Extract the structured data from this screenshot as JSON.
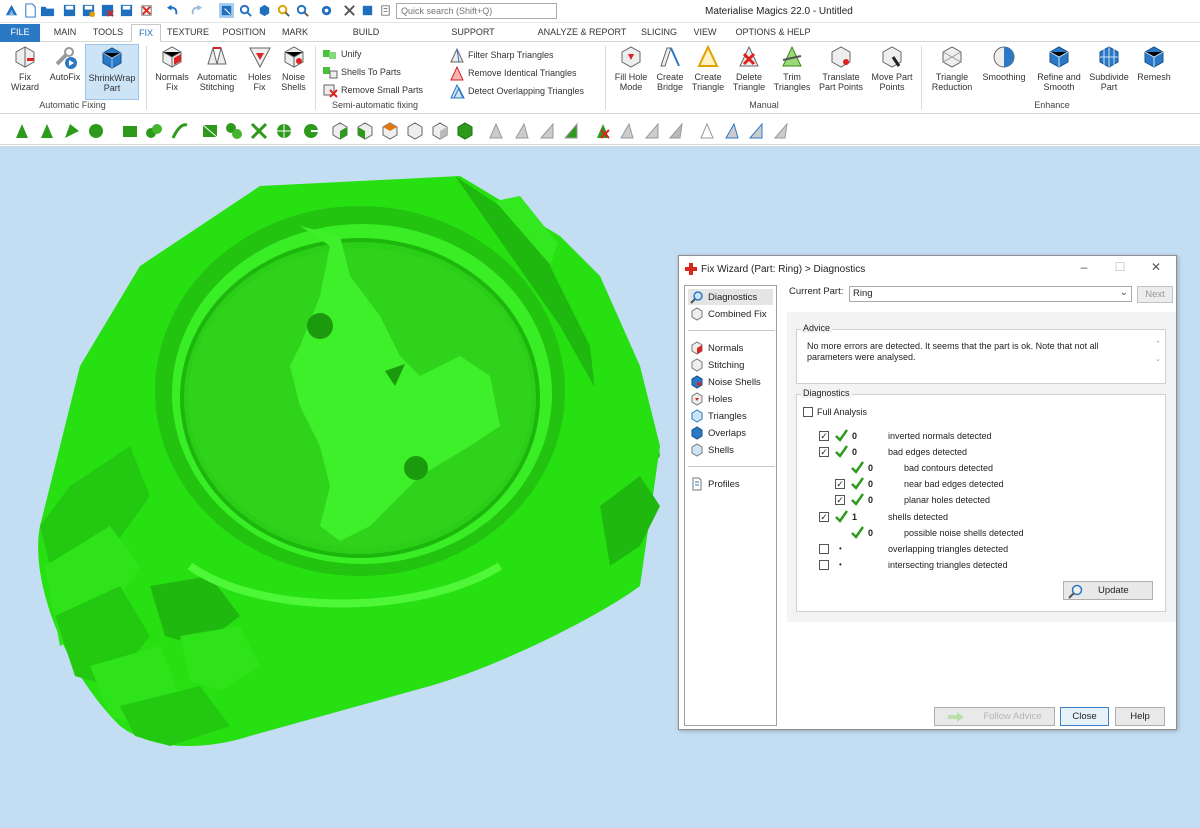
{
  "app": {
    "title": "Materialise Magics 22.0 - Untitled",
    "search_placeholder": "Quick search (Shift+Q)"
  },
  "quick_access": [
    "app-icon",
    "new-icon",
    "open-icon",
    "save-icon",
    "save-as-icon",
    "close-file-icon",
    "delete-icon",
    "undo-icon",
    "redo-icon",
    "select-icon",
    "zoom-icon",
    "rotate-icon",
    "zoom-in-icon",
    "zoom-out-icon",
    "pan-icon",
    "settings-icon",
    "tree-icon",
    "cube-icon",
    "info-icon"
  ],
  "tabs": [
    {
      "label": "FILE",
      "key": "file"
    },
    {
      "label": "MAIN",
      "key": "main"
    },
    {
      "label": "TOOLS",
      "key": "tools"
    },
    {
      "label": "FIX",
      "key": "fix"
    },
    {
      "label": "TEXTURE",
      "key": "texture"
    },
    {
      "label": "POSITION",
      "key": "position"
    },
    {
      "label": "MARK",
      "key": "mark"
    },
    {
      "label": "BUILD PREPARATION",
      "key": "build"
    },
    {
      "label": "SUPPORT GENERATION",
      "key": "support"
    },
    {
      "label": "ANALYZE & REPORT",
      "key": "analyze"
    },
    {
      "label": "SLICING",
      "key": "slicing"
    },
    {
      "label": "VIEW",
      "key": "view"
    },
    {
      "label": "OPTIONS & HELP",
      "key": "options"
    }
  ],
  "active_tab": "FIX",
  "ribbon": {
    "automatic_fixing": {
      "label": "Automatic Fixing",
      "fix_wizard": "Fix\nWizard",
      "autofix": "AutoFix",
      "shrinkwrap": "ShrinkWrap\nPart"
    },
    "group2": {
      "normals_fix": "Normals\nFix",
      "auto_stitching": "Automatic\nStitching",
      "holes_fix": "Holes\nFix",
      "noise_shells": "Noise\nShells"
    },
    "semi": {
      "label": "Semi-automatic fixing",
      "unify": "Unify",
      "shells_to_parts": "Shells To Parts",
      "remove_small_parts": "Remove Small Parts"
    },
    "triangles": {
      "filter_sharp": "Filter Sharp Triangles",
      "remove_identical": "Remove Identical Triangles",
      "detect_overlapping": "Detect Overlapping Triangles"
    },
    "manual": {
      "label": "Manual",
      "fill_hole": "Fill Hole\nMode",
      "create_bridge": "Create\nBridge",
      "create_triangle": "Create\nTriangle",
      "delete_triangle": "Delete\nTriangle",
      "trim_triangles": "Trim\nTriangles",
      "translate_points": "Translate\nPart Points",
      "move_points": "Move Part\nPoints"
    },
    "enhance": {
      "label": "Enhance",
      "triangle_reduction": "Triangle\nReduction",
      "smoothing": "Smoothing",
      "refine_smooth": "Refine and\nSmooth",
      "subdivide": "Subdivide\nPart",
      "remesh": "Remesh"
    }
  },
  "colors": {
    "model_green": "#27e012",
    "viewport_bg": "#c3ddf3",
    "accent_blue": "#2b78c5",
    "check_green": "#2e9a1c"
  },
  "dialog": {
    "title": "Fix Wizard (Part: Ring) > Diagnostics",
    "nav": {
      "diagnostics": "Diagnostics",
      "combined_fix": "Combined Fix",
      "normals": "Normals",
      "stitching": "Stitching",
      "noise_shells": "Noise Shells",
      "holes": "Holes",
      "triangles": "Triangles",
      "overlaps": "Overlaps",
      "shells": "Shells",
      "profiles": "Profiles"
    },
    "current_part_label": "Current Part:",
    "current_part_value": "Ring",
    "next_label": "Next",
    "advice_title": "Advice",
    "advice_text": "No more errors are detected. It seems that the part is ok. Note that not all parameters were analysed.",
    "diagnostics_title": "Diagnostics",
    "full_analysis_label": "Full Analysis",
    "full_analysis_checked": false,
    "rows": [
      {
        "checkbox": true,
        "checked": true,
        "status": "ok",
        "value": "0",
        "label": "inverted normals detected",
        "indent": 0
      },
      {
        "checkbox": true,
        "checked": true,
        "status": "ok",
        "value": "0",
        "label": "bad edges detected",
        "indent": 0
      },
      {
        "checkbox": false,
        "checked": false,
        "status": "ok",
        "value": "0",
        "label": "bad contours detected",
        "indent": 1
      },
      {
        "checkbox": true,
        "checked": true,
        "status": "ok",
        "value": "0",
        "label": "near bad edges detected",
        "indent": 1
      },
      {
        "checkbox": true,
        "checked": true,
        "status": "ok",
        "value": "0",
        "label": "planar holes detected",
        "indent": 1
      },
      {
        "checkbox": true,
        "checked": true,
        "status": "ok",
        "value": "1",
        "label": "shells detected",
        "indent": 0
      },
      {
        "checkbox": false,
        "checked": false,
        "status": "ok",
        "value": "0",
        "label": "possible noise shells detected",
        "indent": 1
      },
      {
        "checkbox": true,
        "checked": false,
        "status": "none",
        "value": "",
        "label": "overlapping triangles detected",
        "indent": 0
      },
      {
        "checkbox": true,
        "checked": false,
        "status": "none",
        "value": "",
        "label": "intersecting triangles detected",
        "indent": 0
      }
    ],
    "update_label": "Update",
    "follow_advice_label": "Follow Advice",
    "close_label": "Close",
    "help_label": "Help"
  }
}
